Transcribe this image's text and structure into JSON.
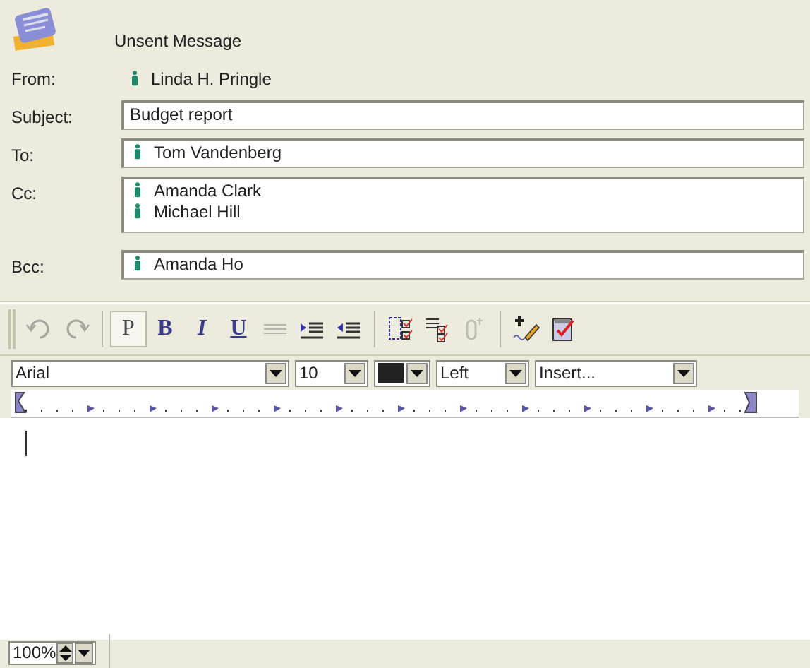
{
  "header": {
    "title": "Unsent Message"
  },
  "from": {
    "label": "From:",
    "name": "Linda H. Pringle"
  },
  "subject": {
    "label": "Subject:",
    "value": "Budget report"
  },
  "to": {
    "label": "To:",
    "recipients": [
      "Tom Vandenberg"
    ]
  },
  "cc": {
    "label": "Cc:",
    "recipients": [
      "Amanda Clark",
      "Michael Hill"
    ]
  },
  "bcc": {
    "label": "Bcc:",
    "recipients": [
      "Amanda Ho"
    ]
  },
  "toolbar": [
    [
      {
        "kind": "undo",
        "disabled": true
      },
      {
        "kind": "redo",
        "disabled": true
      }
    ],
    [
      {
        "kind": "text",
        "label": "P",
        "disabled": false,
        "selected": true
      },
      {
        "kind": "text",
        "label": "B",
        "disabled": false,
        "selected": false
      },
      {
        "kind": "text",
        "label": "I",
        "disabled": false,
        "selected": false
      },
      {
        "kind": "text",
        "label": "U",
        "disabled": false,
        "selected": false
      },
      {
        "kind": "strike",
        "disabled": true
      },
      {
        "kind": "indent",
        "disabled": false
      },
      {
        "kind": "outdent",
        "disabled": false
      }
    ],
    [
      {
        "kind": "checkboxes",
        "disabled": false
      },
      {
        "kind": "checklist",
        "disabled": false
      },
      {
        "kind": "clip",
        "disabled": true
      }
    ],
    [
      {
        "kind": "spell",
        "disabled": false
      },
      {
        "kind": "checkdoc",
        "disabled": false
      }
    ]
  ],
  "format": {
    "font": "Arial",
    "size": "10",
    "align": "Left",
    "insert": "Insert..."
  },
  "status": {
    "zoom": "100%"
  }
}
